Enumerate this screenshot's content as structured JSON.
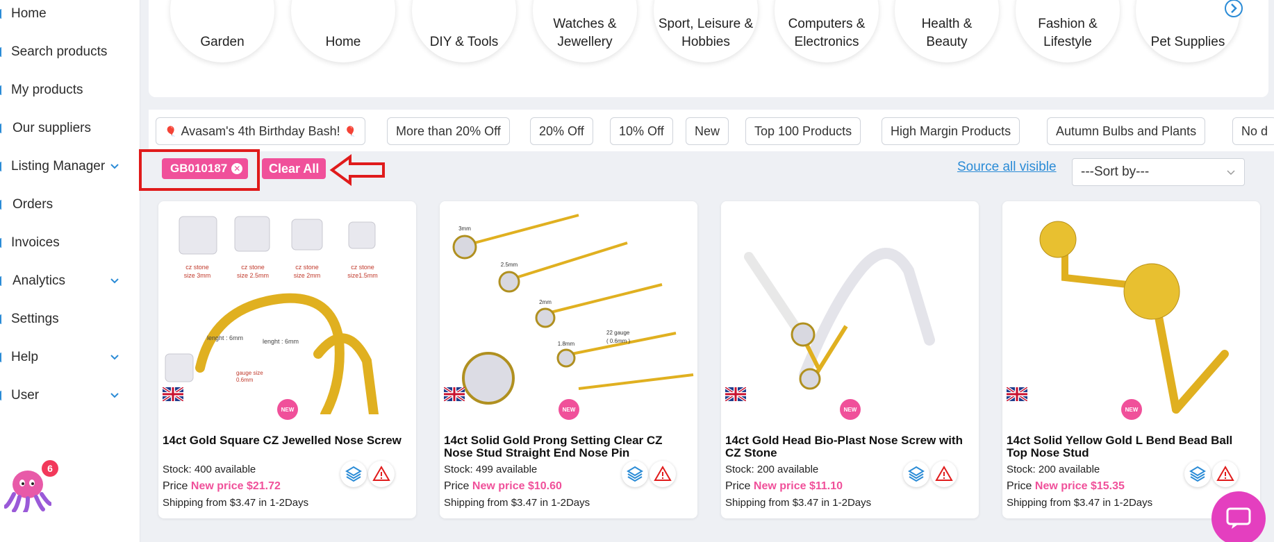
{
  "sidebar": {
    "items": [
      {
        "label": "Home",
        "has_chevron": false
      },
      {
        "label": "Search products",
        "has_chevron": false
      },
      {
        "label": "My products",
        "has_chevron": false
      },
      {
        "label": "Our suppliers",
        "has_chevron": false
      },
      {
        "label": "Listing Manager",
        "has_chevron": true
      },
      {
        "label": "Orders",
        "has_chevron": false
      },
      {
        "label": "Invoices",
        "has_chevron": false
      },
      {
        "label": "Analytics",
        "has_chevron": true
      },
      {
        "label": "Settings",
        "has_chevron": false
      },
      {
        "label": "Help",
        "has_chevron": true
      },
      {
        "label": "User",
        "has_chevron": true
      }
    ],
    "notification_count": "6"
  },
  "categories": [
    {
      "label": "Garden"
    },
    {
      "label": "Home"
    },
    {
      "label": "DIY & Tools"
    },
    {
      "label": "Watches &\nJewellery"
    },
    {
      "label": "Sport, Leisure &\nHobbies"
    },
    {
      "label": "Computers &\nElectronics"
    },
    {
      "label": "Health &\nBeauty"
    },
    {
      "label": "Fashion &\nLifestyle"
    },
    {
      "label": "Pet Supplies"
    }
  ],
  "filter_chips": [
    {
      "label": "Avasam's 4th Birthday Bash!",
      "icon": "balloon-icon"
    },
    {
      "label": "More than 20% Off"
    },
    {
      "label": "20% Off"
    },
    {
      "label": "10% Off"
    },
    {
      "label": "New"
    },
    {
      "label": "Top 100 Products"
    },
    {
      "label": "High Margin Products"
    },
    {
      "label": "Autumn Bulbs and Plants"
    },
    {
      "label": "No d"
    }
  ],
  "active_filter": {
    "tag": "GB010187",
    "clear_all": "Clear All"
  },
  "toolbar": {
    "source_all_visible": "Source all visible",
    "sort_by": "---Sort by---"
  },
  "products": [
    {
      "title": "14ct Gold Square CZ Jewelled Nose Screw",
      "stock_label": "Stock:",
      "stock_value": "400 available",
      "price_label": "Price",
      "new_price": "New price $21.72",
      "shipping": "Shipping from $3.47 in 1-2Days",
      "badge": "NEW",
      "image_texts": [
        "cz stone\nsize 3mm",
        "cz stone\nsize 2.5mm",
        "cz stone\nsize 2mm",
        "cz stone\nsize1.5mm",
        "lenght : 6mm",
        "lenght : 6mm",
        "gauge size\n0.6mm"
      ]
    },
    {
      "title": "14ct Solid Gold Prong Setting Clear CZ Nose Stud Straight End Nose Pin",
      "stock_label": "Stock:",
      "stock_value": "499 available",
      "price_label": "Price",
      "new_price": "New price $10.60",
      "shipping": "Shipping from $3.47 in 1-2Days",
      "badge": "NEW",
      "image_texts": [
        "3mm",
        "2.5mm",
        "2mm",
        "1.8mm",
        "22 gauge\n( 0.6mm )"
      ]
    },
    {
      "title": "14ct Gold Head Bio-Plast Nose Screw with CZ Stone",
      "stock_label": "Stock:",
      "stock_value": "200 available",
      "price_label": "Price",
      "new_price": "New price $11.10",
      "shipping": "Shipping from $3.47 in 1-2Days",
      "badge": "NEW",
      "image_texts": []
    },
    {
      "title": "14ct Solid Yellow Gold L Bend Bead Ball Top Nose Stud",
      "stock_label": "Stock:",
      "stock_value": "200 available",
      "price_label": "Price",
      "new_price": "New price $15.35",
      "shipping": "Shipping from $3.47 in 1-2Days",
      "badge": "NEW",
      "image_texts": []
    }
  ],
  "colors": {
    "accent_pink": "#f0509a",
    "link_blue": "#2a8bd6",
    "highlight_red": "#e01b1b",
    "chat_purple": "#e43fbf"
  }
}
